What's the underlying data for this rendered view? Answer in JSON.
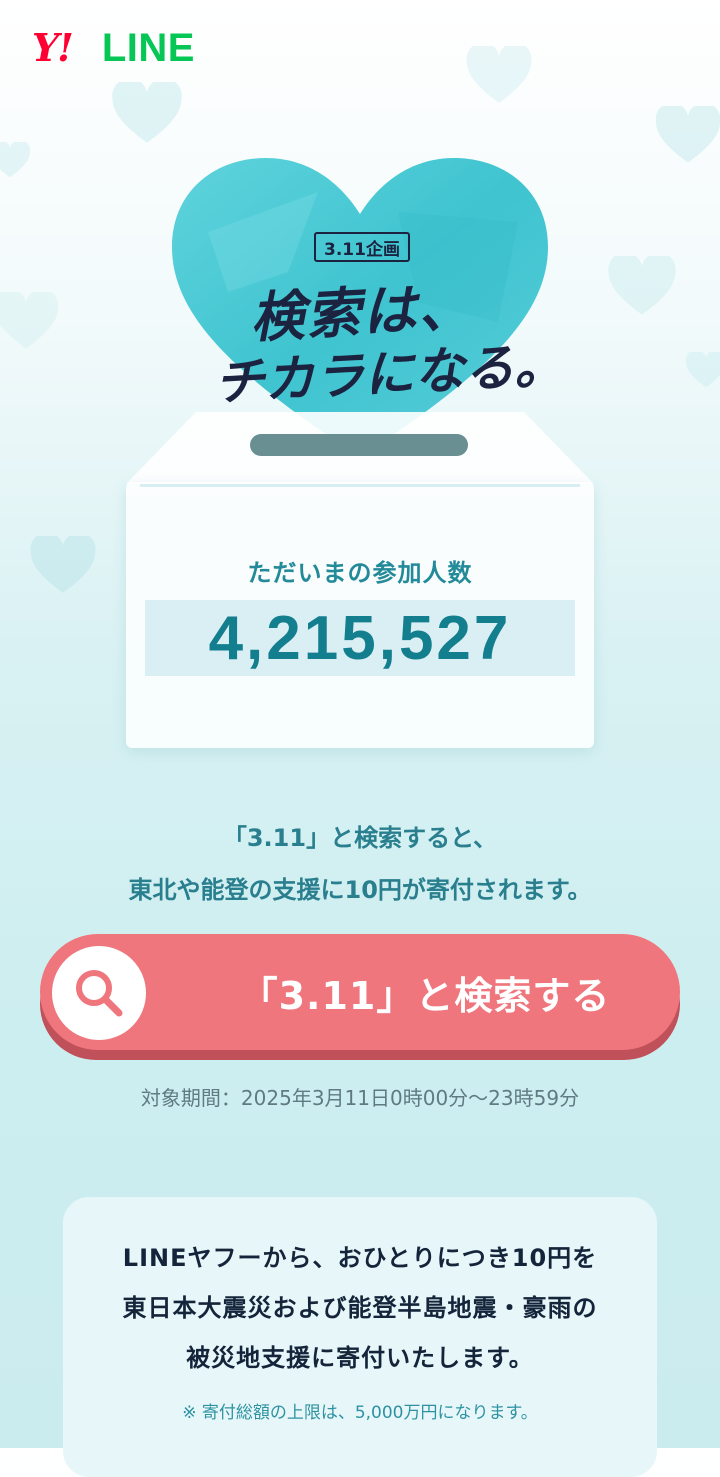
{
  "brand": {
    "yahoo_logo": "Y!",
    "line_logo": "LINE"
  },
  "hero": {
    "badge": "3.11企画",
    "title_line1": "検索は、",
    "title_line2": "チカラになる。",
    "heart_color": "#4cc9d4"
  },
  "counter": {
    "label": "ただいまの参加人数",
    "value": "4,215,527"
  },
  "description": {
    "line1": "「3.11」と検索すると、",
    "line2": "東北や能登の支援に10円が寄付されます。"
  },
  "search_button": {
    "label": "「3.11」と検索する",
    "icon": "search-icon",
    "color": "#f0767d"
  },
  "period": "対象期間：2025年3月11日0時00分〜23時59分",
  "info": {
    "line1": "LINEヤフーから、おひとりにつき10円を",
    "line2": "東日本大震災および能登半島地震・豪雨の",
    "line3": "被災地支援に寄付いたします。",
    "note": "※ 寄付総額の上限は、5,000万円になります。"
  }
}
